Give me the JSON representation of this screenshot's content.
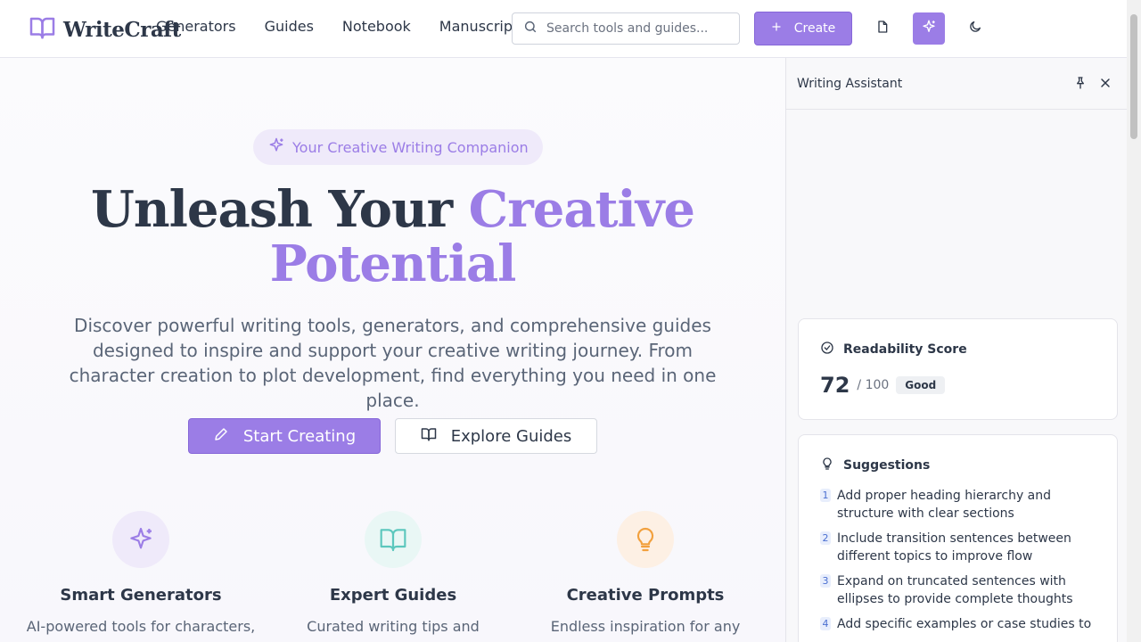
{
  "header": {
    "brand": "WriteCraft",
    "nav": [
      "Generators",
      "Guides",
      "Notebook",
      "Manuscripts"
    ],
    "search_placeholder": "Search tools and guides...",
    "create_label": "Create"
  },
  "hero": {
    "pill_label": "Your Creative Writing Companion",
    "title_plain": "Unleash Your ",
    "title_accent_1": "Creative",
    "title_accent_2": "Potential",
    "subtitle": "Discover powerful writing tools, generators, and comprehensive guides designed to inspire and support your creative writing journey. From character creation to plot development, find everything you need in one place.",
    "primary_button": "Start Creating",
    "secondary_button": "Explore Guides"
  },
  "features": [
    {
      "title": "Smart Generators",
      "desc": "AI-powered tools for characters,",
      "icon": "sparkles-icon"
    },
    {
      "title": "Expert Guides",
      "desc": "Curated writing tips and",
      "icon": "book-open-icon"
    },
    {
      "title": "Creative Prompts",
      "desc": "Endless inspiration for any genre",
      "icon": "lightbulb-icon"
    }
  ],
  "assistant": {
    "title": "Writing Assistant",
    "readability": {
      "heading": "Readability Score",
      "score": "72",
      "max": "/ 100",
      "badge": "Good"
    },
    "suggestions": {
      "heading": "Suggestions",
      "items": [
        {
          "num": "1",
          "text": "Add proper heading hierarchy and structure with clear sections"
        },
        {
          "num": "2",
          "text": "Include transition sentences between different topics to improve flow"
        },
        {
          "num": "3",
          "text": "Expand on truncated sentences with ellipses to provide complete thoughts"
        },
        {
          "num": "4",
          "text": "Add specific examples or case studies to"
        }
      ]
    }
  },
  "colors": {
    "accent": "#9b7de6",
    "text": "#2d3748",
    "muted": "#5a6577",
    "teal": "#5cc7bd",
    "orange": "#f2a03d"
  }
}
